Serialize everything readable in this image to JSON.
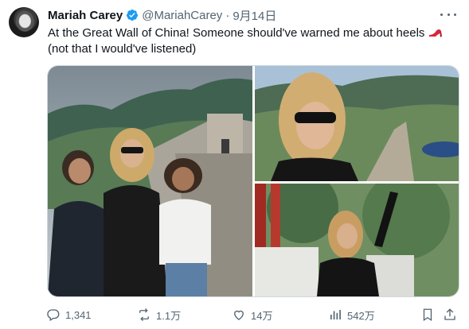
{
  "author": {
    "name": "Mariah Carey",
    "handle": "@MariahCarey",
    "separator": "·",
    "date": "9月14日",
    "verified": true,
    "verified_color": "#1d9bf0"
  },
  "tweet": {
    "text": "At the Great Wall of China! Someone should've warned me about heels",
    "emoji": "high-heel-icon",
    "text_line2": "(not that I would've listened)"
  },
  "media": {
    "count": 3,
    "items": [
      {
        "name": "photo-family-great-wall"
      },
      {
        "name": "photo-sunglasses-closeup"
      },
      {
        "name": "photo-arm-raised"
      }
    ]
  },
  "actions": {
    "reply_count": "1,341",
    "retweet_count": "1.1万",
    "like_count": "14万",
    "view_count": "542万"
  },
  "colors": {
    "text": "#0f1419",
    "secondary": "#536471",
    "border": "#cfd9de"
  }
}
